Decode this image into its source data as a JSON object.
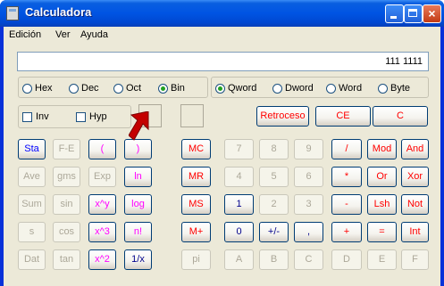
{
  "window": {
    "title": "Calculadora"
  },
  "menu": [
    "Edición",
    "Ver",
    "Ayuda"
  ],
  "display": {
    "value": "111 1111"
  },
  "base_radios": [
    {
      "label": "Hex",
      "selected": false
    },
    {
      "label": "Dec",
      "selected": false
    },
    {
      "label": "Oct",
      "selected": false
    },
    {
      "label": "Bin",
      "selected": true
    }
  ],
  "word_radios": [
    {
      "label": "Qword",
      "selected": true
    },
    {
      "label": "Dword",
      "selected": false
    },
    {
      "label": "Word",
      "selected": false
    },
    {
      "label": "Byte",
      "selected": false
    }
  ],
  "checks": {
    "inv": "Inv",
    "hyp": "Hyp"
  },
  "edit_buttons": {
    "backspace": "Retroceso",
    "ce": "CE",
    "c": "C"
  },
  "sci": [
    [
      "Sta",
      "F-E",
      "(",
      ")"
    ],
    [
      "Ave",
      "gms",
      "Exp",
      "ln"
    ],
    [
      "Sum",
      "sin",
      "x^y",
      "log"
    ],
    [
      "s",
      "cos",
      "x^3",
      "n!"
    ],
    [
      "Dat",
      "tan",
      "x^2",
      "1/x"
    ]
  ],
  "mem": [
    "MC",
    "MR",
    "MS",
    "M+",
    "pi"
  ],
  "keypad": [
    [
      "7",
      "8",
      "9",
      "/",
      "Mod",
      "And"
    ],
    [
      "4",
      "5",
      "6",
      "*",
      "Or",
      "Xor"
    ],
    [
      "1",
      "2",
      "3",
      "-",
      "Lsh",
      "Not"
    ],
    [
      "0",
      "+/-",
      ",",
      "+",
      "=",
      "Int"
    ],
    [
      "A",
      "B",
      "C",
      "D",
      "E",
      "F"
    ]
  ],
  "colors": {
    "titlebar": "#0054e3",
    "face": "#ece9d8",
    "cursor": "#cc0000"
  }
}
